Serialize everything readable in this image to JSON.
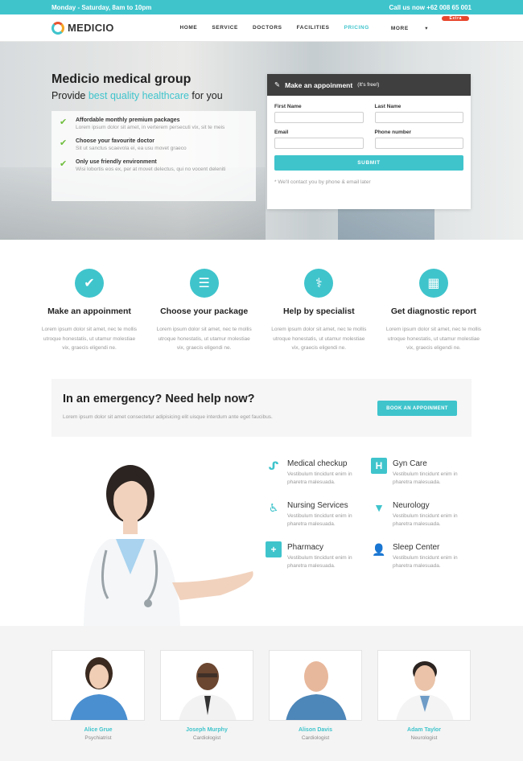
{
  "topbar": {
    "hours": "Monday - Saturday, 8am to 10pm",
    "phone": "Call us now +62 008 65 001"
  },
  "brand": {
    "name": "MEDICIO"
  },
  "nav": {
    "items": [
      "HOME",
      "SERVICE",
      "DOCTORS",
      "FACILITIES",
      "PRICING",
      "MORE"
    ],
    "active": "PRICING",
    "extra_badge": "Extra"
  },
  "hero": {
    "title": "Medicio medical group",
    "subtitle_pre": "Provide ",
    "subtitle_highlight": "best quality healthcare",
    "subtitle_post": " for you",
    "features": [
      {
        "title": "Affordable monthly premium packages",
        "desc": "Lorem ipsum dolor sit amet, in verterem persecuti vix, sit te meis"
      },
      {
        "title": "Choose your favourite doctor",
        "desc": "Sit ut sanctus scaevola ei, ea usu movet graeco"
      },
      {
        "title": "Only use friendly environment",
        "desc": "Wisi lobortis eos ex, per at movet delectus, qui no vocent deleniti"
      }
    ]
  },
  "form": {
    "header": "Make an appoinment",
    "header_note": "(It's free!)",
    "first_name_label": "First Name",
    "last_name_label": "Last Name",
    "email_label": "Email",
    "phone_label": "Phone number",
    "submit": "SUBMIT",
    "note": "* We'll contact you by phone & email later"
  },
  "steps": [
    {
      "icon": "check-icon",
      "title": "Make an appoinment",
      "desc": "Lorem ipsum dolor sit amet, nec te mollis utroque honestatis, ut utamur molestiae vix, graecis eligendi ne."
    },
    {
      "icon": "list-icon",
      "title": "Choose your package",
      "desc": "Lorem ipsum dolor sit amet, nec te mollis utroque honestatis, ut utamur molestiae vix, graecis eligendi ne."
    },
    {
      "icon": "doctor-icon",
      "title": "Help by specialist",
      "desc": "Lorem ipsum dolor sit amet, nec te mollis utroque honestatis, ut utamur molestiae vix, graecis eligendi ne."
    },
    {
      "icon": "hospital-icon",
      "title": "Get diagnostic report",
      "desc": "Lorem ipsum dolor sit amet, nec te mollis utroque honestatis, ut utamur molestiae vix, graecis eligendi ne."
    }
  ],
  "emergency": {
    "title": "In an emergency? Need help now?",
    "desc": "Lorem ipsum dolor sit amet consectetur adipisicing elit uisque interdum ante eget faucibus.",
    "button": "BOOK AN APPOINMENT"
  },
  "services": [
    {
      "icon": "stethoscope-icon",
      "title": "Medical checkup",
      "desc": "Vestibulum tincidunt enim in pharetra malesuada."
    },
    {
      "icon": "h-icon",
      "title": "Gyn Care",
      "desc": "Vestibulum tincidunt enim in pharetra malesuada."
    },
    {
      "icon": "wheelchair-icon",
      "title": "Nursing Services",
      "desc": "Vestibulum tincidunt enim in pharetra malesuada."
    },
    {
      "icon": "filter-icon",
      "title": "Neurology",
      "desc": "Vestibulum tincidunt enim in pharetra malesuada."
    },
    {
      "icon": "plus-icon",
      "title": "Pharmacy",
      "desc": "Vestibulum tincidunt enim in pharetra malesuada."
    },
    {
      "icon": "user-md-icon",
      "title": "Sleep Center",
      "desc": "Vestibulum tincidunt enim in pharetra malesuada."
    }
  ],
  "team": [
    {
      "name": "Alice Grue",
      "role": "Psychiatrist"
    },
    {
      "name": "Joseph Murphy",
      "role": "Cardiologist"
    },
    {
      "name": "Alison Davis",
      "role": "Cardiologist"
    },
    {
      "name": "Adam Taylor",
      "role": "Neurologist"
    }
  ],
  "colors": {
    "accent": "#3fc4cc",
    "badge": "#e8452c",
    "check": "#6ebd3c",
    "dark": "#3f3f3f"
  }
}
